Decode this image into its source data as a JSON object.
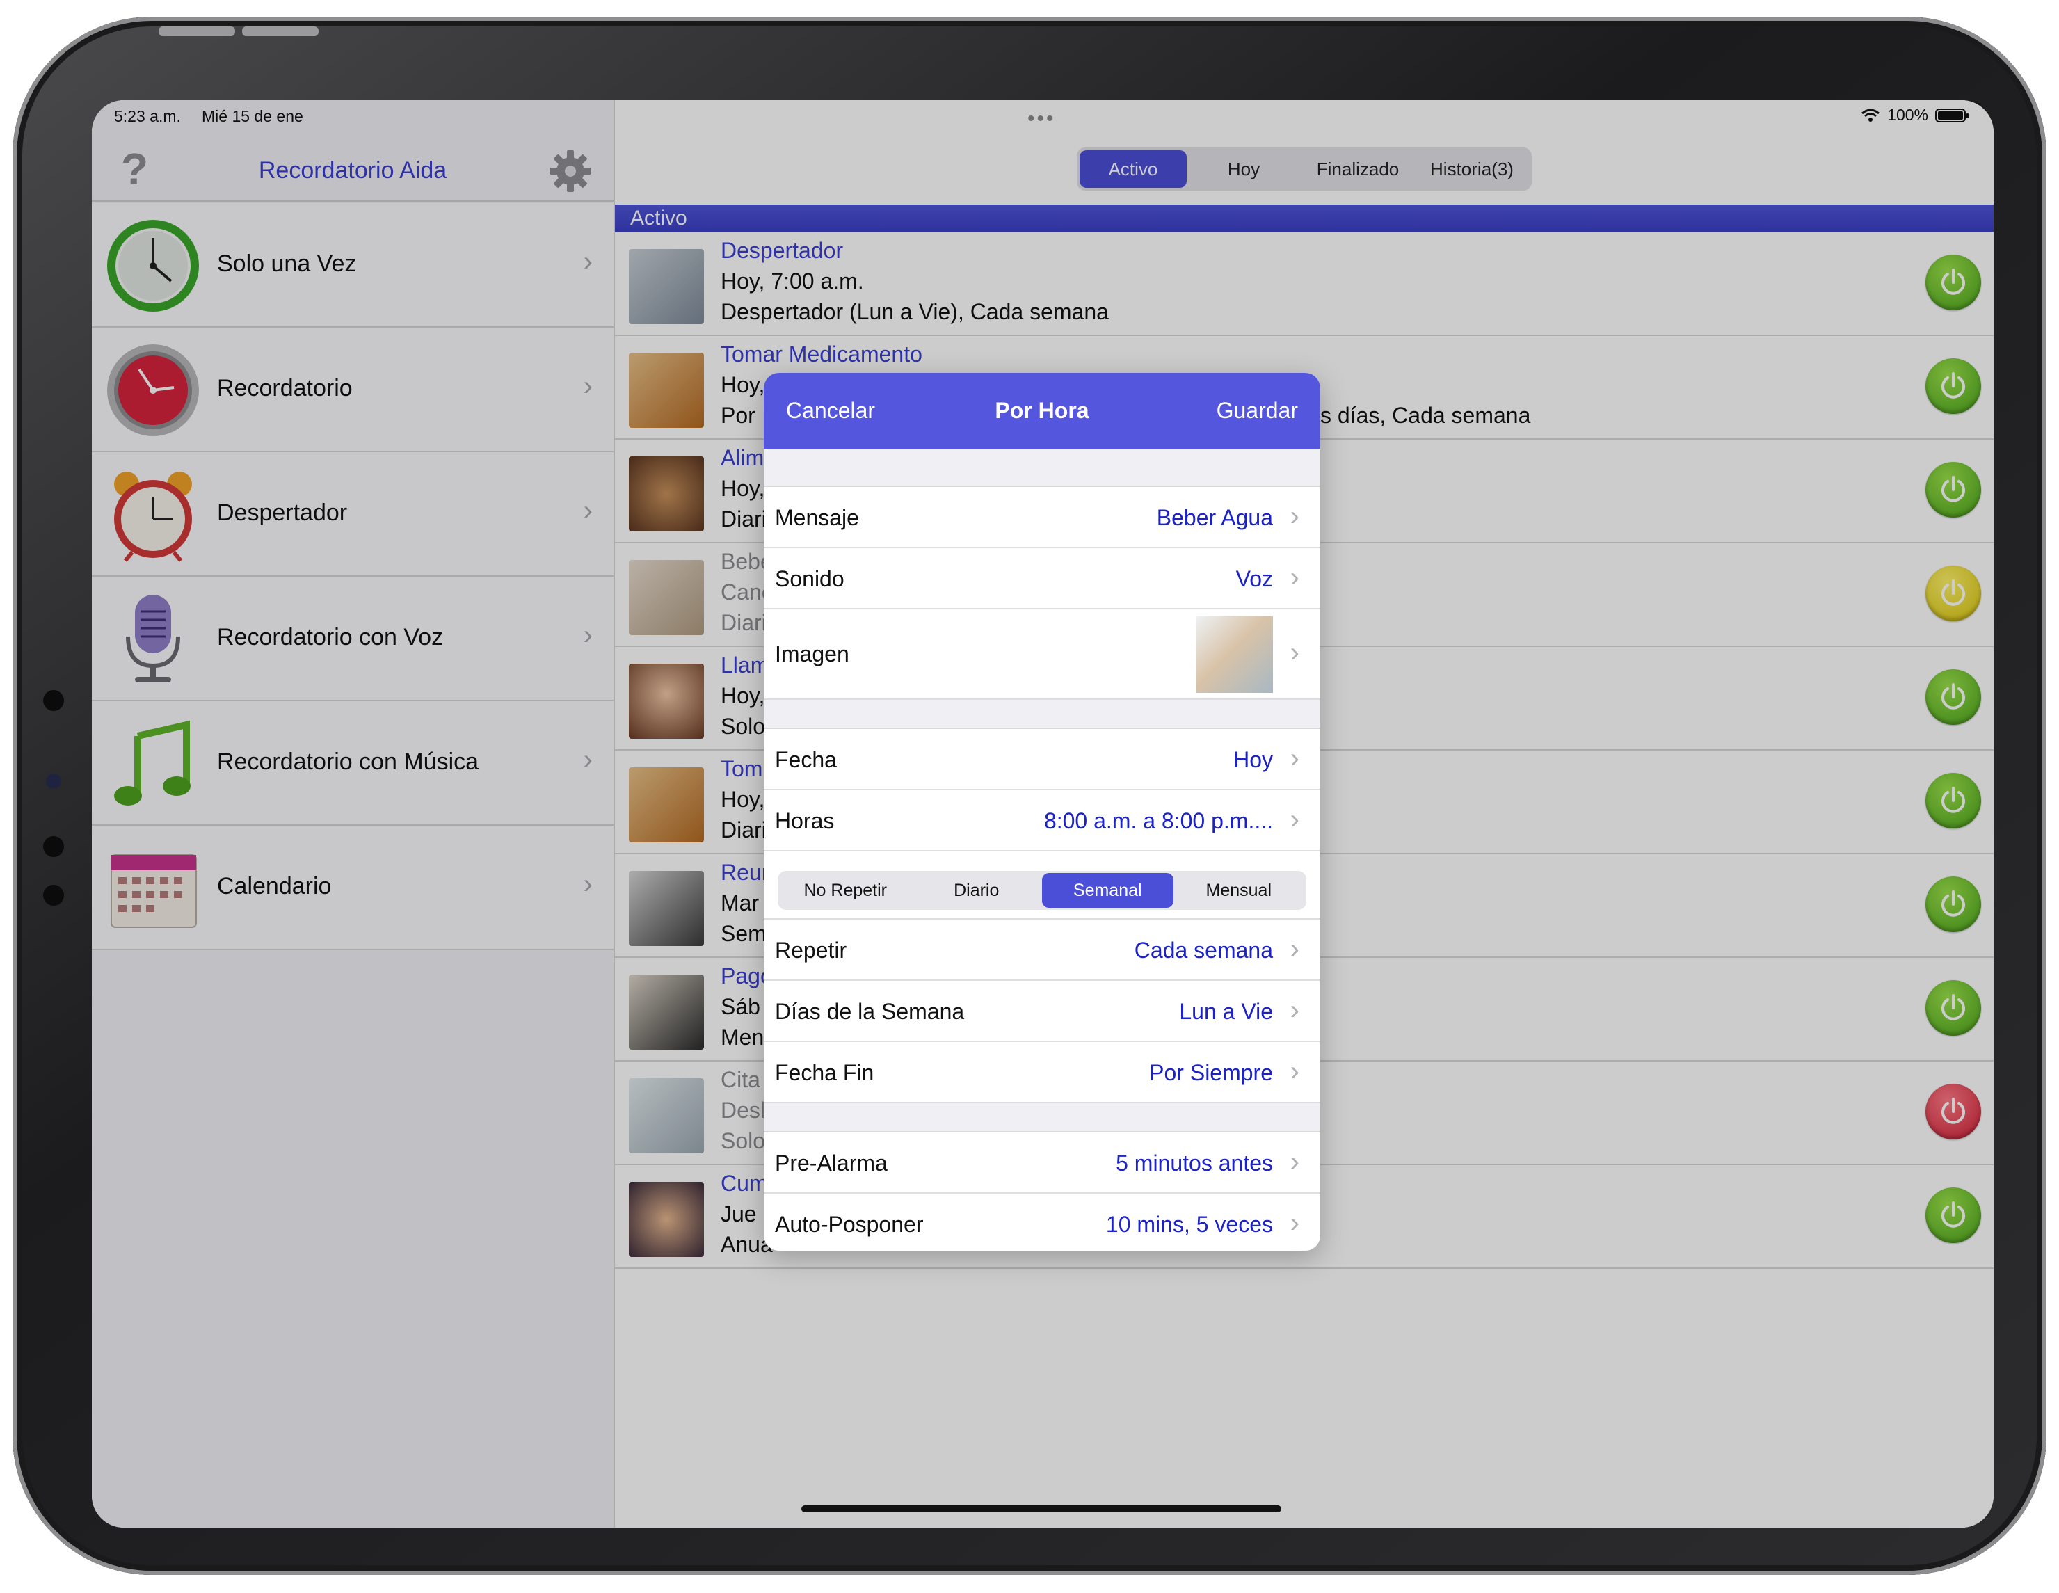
{
  "status": {
    "time": "5:23 a.m.",
    "date": "Mié 15 de ene",
    "battery": "100%"
  },
  "sidebar": {
    "title": "Recordatorio Aida",
    "help": "?",
    "items": [
      {
        "label": "Solo una Vez",
        "icon": "clock-green-icon"
      },
      {
        "label": "Recordatorio",
        "icon": "clock-red-icon"
      },
      {
        "label": "Despertador",
        "icon": "alarm-clock-icon"
      },
      {
        "label": "Recordatorio con Voz",
        "icon": "microphone-icon"
      },
      {
        "label": "Recordatorio con Música",
        "icon": "music-note-icon"
      },
      {
        "label": "Calendario",
        "icon": "calendar-icon"
      }
    ]
  },
  "tabs": [
    {
      "label": "Activo",
      "selected": true
    },
    {
      "label": "Hoy",
      "selected": false
    },
    {
      "label": "Finalizado",
      "selected": false
    },
    {
      "label": "Historia(3)",
      "selected": false
    }
  ],
  "section": "Activo",
  "reminders": [
    {
      "title": "Despertador",
      "line2": "Hoy, 7:00 a.m.",
      "line3": "Despertador (Lun a Vie), Cada semana",
      "status": "green",
      "dim": false,
      "thumb": "#9aa6b4"
    },
    {
      "title": "Tomar Medicamento",
      "line2": "Hoy,",
      "line3": "Por",
      "line3_right": "s días, Cada semana",
      "status": "green",
      "dim": false,
      "thumb": "#d28b3a"
    },
    {
      "title": "Alim",
      "line2": "Hoy,",
      "line3": "Diari",
      "status": "green",
      "dim": false,
      "thumb": "#8a5a3a"
    },
    {
      "title": "Bebe",
      "line2": "Canc",
      "line3": "Diari",
      "status": "yellow",
      "dim": true,
      "thumb": "#c9b59a"
    },
    {
      "title": "Llam",
      "line2": "Hoy,",
      "line3": "Solo",
      "status": "green",
      "dim": false,
      "thumb": "#b07a5a"
    },
    {
      "title": "Tom",
      "line2": "Hoy,",
      "line3": "Diari",
      "status": "green",
      "dim": false,
      "thumb": "#d28b3a"
    },
    {
      "title": "Reun",
      "line2": "Mar",
      "line3": "Sem",
      "status": "green",
      "dim": false,
      "thumb": "#5a5a5a"
    },
    {
      "title": "Pago",
      "line2": "Sáb",
      "line3": "Men",
      "status": "green",
      "dim": false,
      "thumb": "#6a6a6a"
    },
    {
      "title": "Cita",
      "line2": "Desl",
      "line3": "Solo",
      "status": "red",
      "dim": true,
      "thumb": "#b8c2c8"
    },
    {
      "title": "Cum",
      "line2": "Jue",
      "line3": "Anua",
      "status": "green",
      "dim": false,
      "thumb": "#7a6050"
    }
  ],
  "modal": {
    "cancel": "Cancelar",
    "title": "Por Hora",
    "save": "Guardar",
    "fields": {
      "mensaje": {
        "label": "Mensaje",
        "value": "Beber Agua"
      },
      "sonido": {
        "label": "Sonido",
        "value": "Voz"
      },
      "imagen": {
        "label": "Imagen"
      },
      "fecha": {
        "label": "Fecha",
        "value": "Hoy"
      },
      "horas": {
        "label": "Horas",
        "value": "8:00 a.m. a 8:00 p.m...."
      },
      "repetir": {
        "label": "Repetir",
        "value": "Cada semana"
      },
      "dias": {
        "label": "Días de la Semana",
        "value": "Lun a Vie"
      },
      "fecha_fin": {
        "label": "Fecha Fin",
        "value": "Por Siempre"
      },
      "pre_alarma": {
        "label": "Pre-Alarma",
        "value": "5 minutos antes"
      },
      "auto_posponer": {
        "label": "Auto-Posponer",
        "value": "10 mins, 5 veces"
      }
    },
    "repeat_options": [
      {
        "label": "No Repetir",
        "selected": false
      },
      {
        "label": "Diario",
        "selected": false
      },
      {
        "label": "Semanal",
        "selected": true
      },
      {
        "label": "Mensual",
        "selected": false
      }
    ]
  },
  "chevron": "›"
}
